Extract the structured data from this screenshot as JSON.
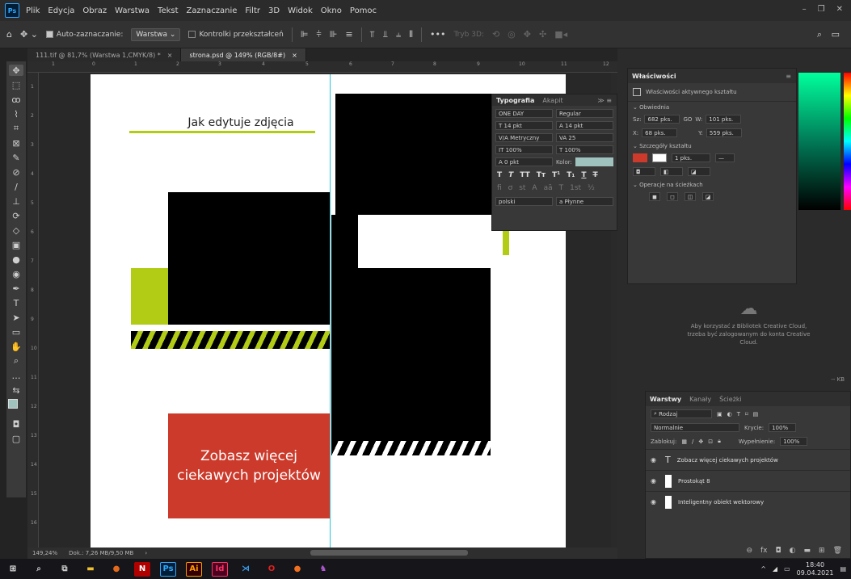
{
  "app": {
    "logo": "Ps",
    "menu": [
      "Plik",
      "Edycja",
      "Obraz",
      "Warstwa",
      "Tekst",
      "Zaznaczanie",
      "Filtr",
      "3D",
      "Widok",
      "Okno",
      "Pomoc"
    ]
  },
  "optionsbar": {
    "auto_select_label": "Auto-zaznaczanie:",
    "auto_select_value": "Warstwa",
    "transform_controls_label": "Kontrolki przekształceń",
    "mode3d_label": "Tryb 3D:"
  },
  "tabs": [
    {
      "label": "111.tif @ 81,7% (Warstwa 1,CMYK/8) *",
      "close": "×"
    },
    {
      "label": "strona.psd @ 149% (RGB/8#)",
      "close": "×"
    }
  ],
  "ruler_top": [
    "1",
    "0",
    "1",
    "2",
    "3",
    "4",
    "5",
    "6",
    "7",
    "8",
    "9",
    "10",
    "11",
    "12"
  ],
  "ruler_left": [
    "1",
    "2",
    "3",
    "4",
    "5",
    "6",
    "7",
    "8",
    "9",
    "10",
    "11",
    "12",
    "13",
    "14",
    "15",
    "16"
  ],
  "document": {
    "heading": "Jak edytuje zdjęcia",
    "cta_line1": "Zobasz więcej",
    "cta_line2": "ciekawych projektów",
    "accent": "#b2cc16",
    "cta_bg": "#cc3a2b"
  },
  "status": {
    "zoom": "149,24%",
    "doc": "Dok.: 7,26 MB/9,50 MB"
  },
  "typography": {
    "tab_active": "Typografia",
    "tab_other": "Akapit",
    "font": "ONE DAY",
    "style": "Regular",
    "size": "14 pkt",
    "leading": "14 pkt",
    "kerning": "Metryczny",
    "tracking": "25",
    "vscale": "100%",
    "hscale": "100%",
    "baseline": "0 pkt",
    "color_label": "Kolor:",
    "color_value": "#9fc2bf",
    "language": "polski",
    "aa_label": "a",
    "antialias": "Płynne"
  },
  "properties": {
    "title": "Właściwości",
    "subtitle": "Właściwości aktywnego kształtu",
    "section_bounds": "Obwiednia",
    "w_label": "Sz:",
    "w_value": "682 pks.",
    "link": "GO",
    "h_label": "W:",
    "h_value": "101 pks.",
    "x_label": "X:",
    "x_value": "68 pks.",
    "y_label": "Y:",
    "y_value": "559 pks.",
    "section_shape": "Szczegóły kształtu",
    "stroke": "1 pks.",
    "section_path": "Operacje na ścieżkach",
    "fill_color": "#cc3a2b"
  },
  "libraries": {
    "message": "Aby korzystać z Bibliotek Creative Cloud, trzeba być zalogowanym do konta Creative Cloud.",
    "kb": "-- KB"
  },
  "layers": {
    "tabs": [
      "Warstwy",
      "Kanały",
      "Ścieżki"
    ],
    "filter": "Rodzaj",
    "blend": "Normalnie",
    "opacity_label": "Krycie:",
    "opacity": "100%",
    "lock_label": "Zablokuj:",
    "fill_label": "Wypełnienie:",
    "fill": "100%",
    "items": [
      {
        "name": "Zobacz więcej ciekawych projektów",
        "kind": "T"
      },
      {
        "name": "Prostokąt 8",
        "kind": "shape"
      },
      {
        "name": "Inteligentny obiekt wektorowy",
        "kind": "smart"
      }
    ]
  },
  "taskbar": {
    "time": "18:40",
    "date": "09.04.2021"
  }
}
